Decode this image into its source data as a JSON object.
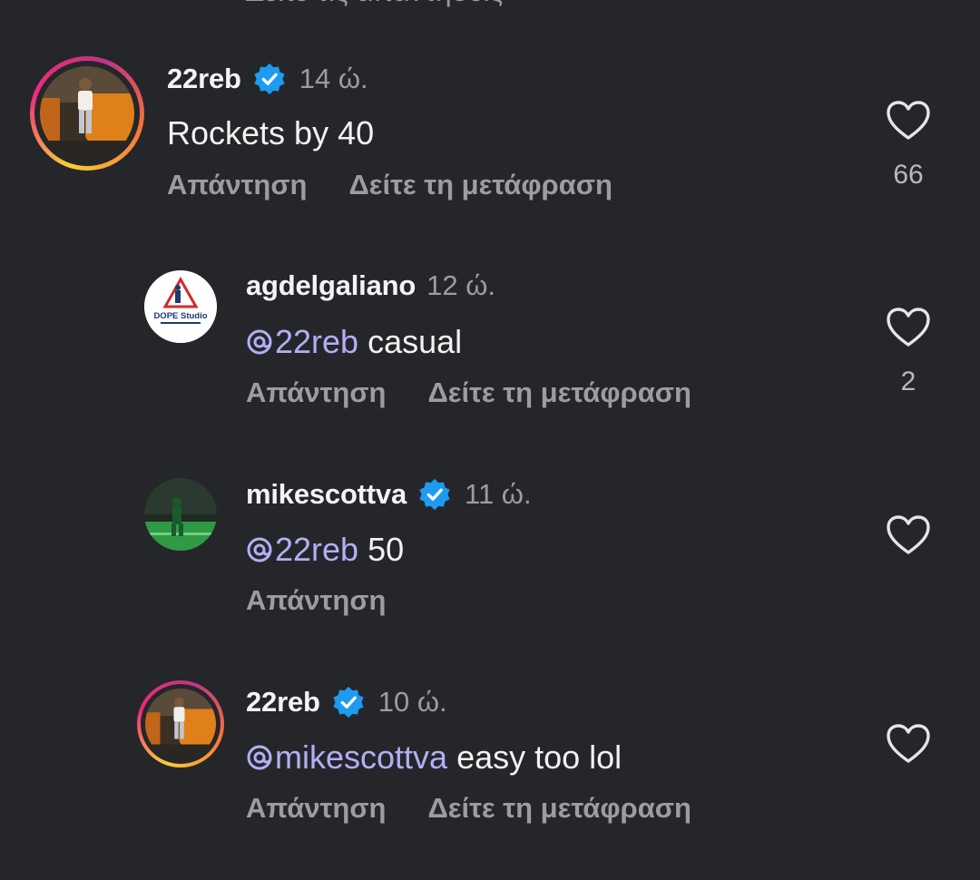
{
  "top_partial_text": "Δείτε τις απαντήσεις",
  "colors": {
    "background": "#25262a",
    "mention": "#b4aef5",
    "verified_badge": "#1d9bf0",
    "muted_text": "#9c9da3"
  },
  "comments": [
    {
      "username": "22reb",
      "verified": true,
      "time": "14 ώ.",
      "text": "Rockets by 40",
      "mention": "",
      "actions": [
        "Απάντηση",
        "Δείτε τη μετάφραση"
      ],
      "likes": "66",
      "avatar_icon": "person-car-avatar"
    },
    {
      "username": "agdelgaliano",
      "verified": false,
      "time": "12 ώ.",
      "mention": "@22reb",
      "text": " casual",
      "actions": [
        "Απάντηση",
        "Δείτε τη μετάφραση"
      ],
      "likes": "2",
      "avatar_icon": "dope-studio-logo",
      "avatar_logo_text": "DOPE Studio"
    },
    {
      "username": "mikescottva",
      "verified": true,
      "time": "11 ώ.",
      "mention": "@22reb",
      "text": " 50",
      "actions": [
        "Απάντηση"
      ],
      "likes": "",
      "avatar_icon": "soccer-field-avatar"
    },
    {
      "username": "22reb",
      "verified": true,
      "time": "10 ώ.",
      "mention": "@mikescottva",
      "text": " easy too lol",
      "actions": [
        "Απάντηση",
        "Δείτε τη μετάφραση"
      ],
      "likes": "",
      "avatar_icon": "person-car-avatar"
    }
  ]
}
